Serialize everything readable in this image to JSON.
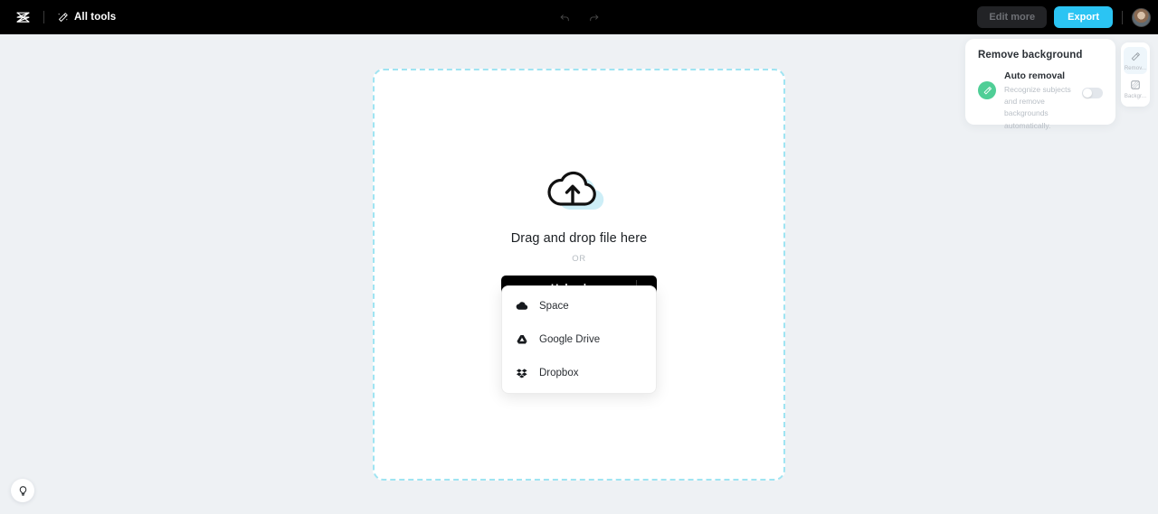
{
  "topbar": {
    "logo_name": "capcut-logo",
    "all_tools_label": "All tools",
    "undo_label": "Undo",
    "redo_label": "Redo",
    "edit_more_label": "Edit more",
    "export_label": "Export",
    "avatar_label": "Account avatar"
  },
  "dropzone": {
    "title": "Drag and drop file here",
    "or_label": "OR",
    "upload_label": "Upload",
    "more_label": "···"
  },
  "upload_menu": {
    "items": [
      {
        "label": "Space",
        "icon": "cloud-icon"
      },
      {
        "label": "Google Drive",
        "icon": "google-drive-icon"
      },
      {
        "label": "Dropbox",
        "icon": "dropbox-icon"
      }
    ]
  },
  "panel": {
    "title": "Remove background",
    "auto_removal": {
      "title": "Auto removal",
      "description": "Recognize subjects and remove backgrounds automatically.",
      "toggle_on": false
    }
  },
  "rail": {
    "items": [
      {
        "label": "Remov...",
        "icon": "magic-wand-icon",
        "active": true
      },
      {
        "label": "Backgr...",
        "icon": "checker-square-icon",
        "active": false
      }
    ]
  },
  "help": {
    "label": "Tips",
    "icon": "lightbulb-icon"
  },
  "colors": {
    "page_background": "#eef1f4",
    "topbar": "#000000",
    "export_accent": "#2bc4f3",
    "dropzone_border": "#9fe4f2",
    "green_badge": "#4fce96"
  }
}
